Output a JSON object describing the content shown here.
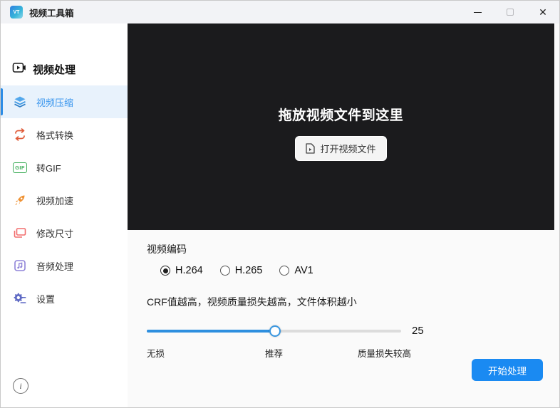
{
  "titlebar": {
    "title": "视频工具箱",
    "app_icon_text": "VT"
  },
  "sidebar": {
    "header": {
      "label": "视频处理"
    },
    "items": [
      {
        "label": "视频压缩",
        "icon": "layers-icon",
        "selected": true
      },
      {
        "label": "格式转换",
        "icon": "convert-arrows-icon",
        "selected": false
      },
      {
        "label": "转GIF",
        "icon": "gif-icon",
        "gif_badge": "GIF",
        "selected": false
      },
      {
        "label": "视频加速",
        "icon": "rocket-icon",
        "selected": false
      },
      {
        "label": "修改尺寸",
        "icon": "resize-icon",
        "selected": false
      },
      {
        "label": "音频处理",
        "icon": "music-note-icon",
        "selected": false
      },
      {
        "label": "设置",
        "icon": "gear-icon",
        "selected": false
      }
    ]
  },
  "dropzone": {
    "title": "拖放视频文件到这里",
    "open_button_label": "打开视频文件"
  },
  "panel": {
    "encoding_label": "视频编码",
    "codecs": [
      {
        "label": "H.264",
        "selected": true
      },
      {
        "label": "H.265",
        "selected": false
      },
      {
        "label": "AV1",
        "selected": false
      }
    ],
    "crf_hint": "CRF值越高，视频质量损失越高，文件体积越小",
    "slider": {
      "value": "25",
      "percent": 50.4,
      "min_label": "无损",
      "mid_label": "推荐",
      "max_label": "质量损失较高"
    },
    "start_button_label": "开始处理"
  },
  "colors": {
    "accent_blue": "#2b8ce6",
    "selected_item_bg": "#e8f2fc",
    "dropzone_bg": "#1b1b1d",
    "slider_fill": "#2e8fdf",
    "start_button": "#1a8af2",
    "titlebar_bg": "#f2f3f6"
  }
}
